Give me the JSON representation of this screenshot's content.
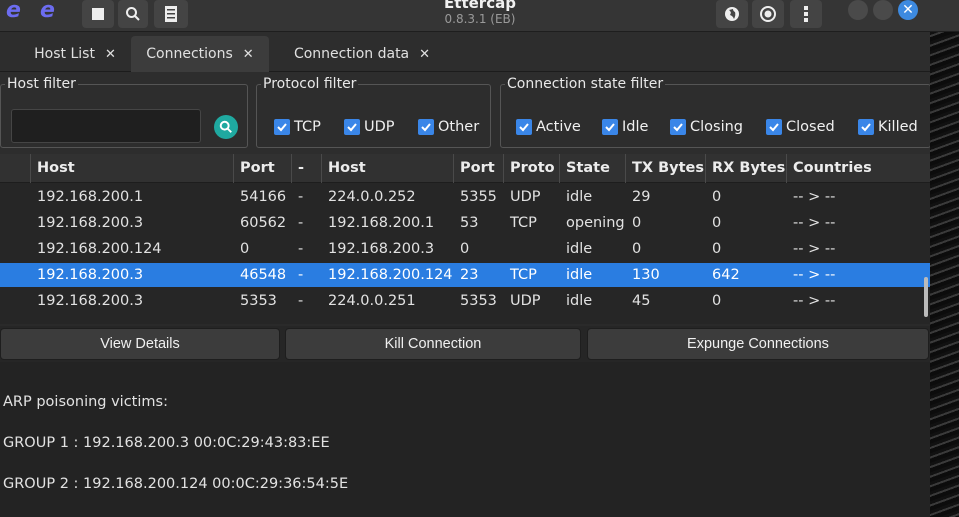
{
  "app": {
    "title": "Ettercap",
    "version": "0.8.3.1 (EB)"
  },
  "header_icons": [
    "ettercap-logo-icon",
    "stop-icon",
    "search-icon",
    "hosts-icon",
    "globe-icon",
    "record-icon",
    "kebab-menu-icon"
  ],
  "tabs": [
    {
      "label": "Host List",
      "active": false
    },
    {
      "label": "Connections",
      "active": true
    },
    {
      "label": "Connection data",
      "active": false
    }
  ],
  "tab_close_glyph": "✕",
  "filters": {
    "host": {
      "label": "Host filter",
      "value": ""
    },
    "protocol": {
      "label": "Protocol filter",
      "options": [
        {
          "label": "TCP",
          "checked": true
        },
        {
          "label": "UDP",
          "checked": true
        },
        {
          "label": "Other",
          "checked": true
        }
      ]
    },
    "state": {
      "label": "Connection state filter",
      "options": [
        {
          "label": "Active",
          "checked": true
        },
        {
          "label": "Idle",
          "checked": true
        },
        {
          "label": "Closing",
          "checked": true
        },
        {
          "label": "Closed",
          "checked": true
        },
        {
          "label": "Killed",
          "checked": true
        }
      ]
    }
  },
  "table": {
    "columns": [
      "Host",
      "Port",
      "-",
      "Host",
      "Port",
      "Proto",
      "State",
      "TX Bytes",
      "RX Bytes",
      "Countries"
    ],
    "rows": [
      [
        "192.168.200.1",
        "54166",
        "-",
        "224.0.0.252",
        "5355",
        "UDP",
        "idle",
        "29",
        "0",
        "-- > --"
      ],
      [
        "192.168.200.3",
        "60562",
        "-",
        "192.168.200.1",
        "53",
        "TCP",
        "opening",
        "0",
        "0",
        "-- > --"
      ],
      [
        "192.168.200.124",
        "0",
        "-",
        "192.168.200.3",
        "0",
        "",
        "idle",
        "0",
        "0",
        "-- > --"
      ],
      [
        "192.168.200.3",
        "46548",
        "-",
        "192.168.200.124",
        "23",
        "TCP",
        "idle",
        "130",
        "642",
        "-- > --"
      ],
      [
        "192.168.200.3",
        "5353",
        "-",
        "224.0.0.251",
        "5353",
        "UDP",
        "idle",
        "45",
        "0",
        "-- > --"
      ]
    ],
    "selected_row": 3
  },
  "buttons": {
    "view_details": "View Details",
    "kill_connection": "Kill Connection",
    "expunge_connections": "Expunge Connections"
  },
  "log": {
    "lines": [
      "ARP poisoning victims:",
      "GROUP 1 : 192.168.200.3 00:0C:29:43:83:EE",
      "GROUP 2 : 192.168.200.124 00:0C:29:36:54:5E"
    ]
  },
  "colors": {
    "accent": "#2a7de1",
    "checkbox": "#3a86e8",
    "search_button": "#1fa9a0"
  }
}
